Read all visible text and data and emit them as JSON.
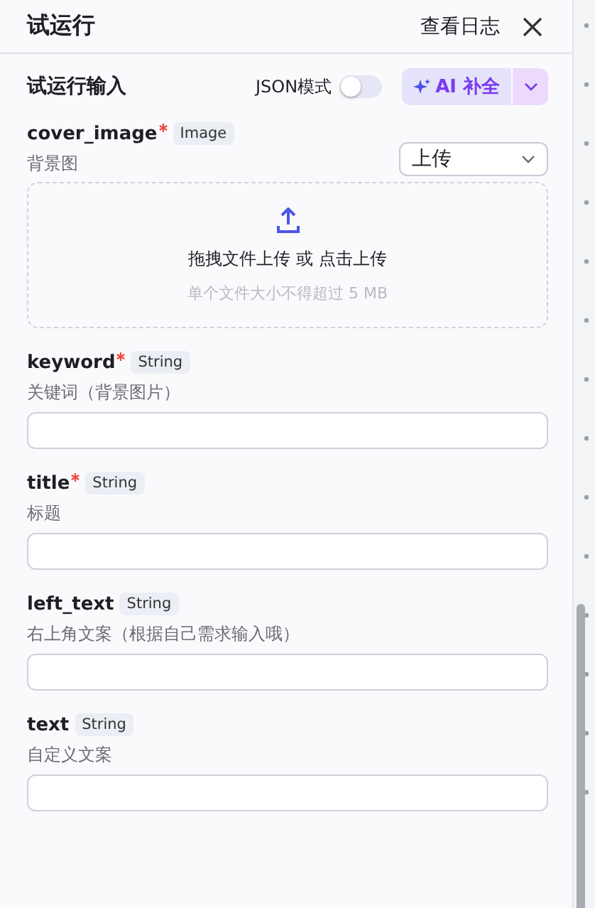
{
  "header": {
    "title": "试运行",
    "log_link": "查看日志"
  },
  "section": {
    "title": "试运行输入",
    "json_mode": {
      "label": "JSON模式",
      "on": false
    },
    "ai_button": "AI 补全"
  },
  "fields": [
    {
      "kind": "upload",
      "name": "cover_image",
      "required": true,
      "type": "Image",
      "description": "背景图",
      "mode": "上传",
      "upload_text": "拖拽文件上传 或 点击上传",
      "upload_hint": "单个文件大小不得超过 5 MB"
    },
    {
      "kind": "text",
      "name": "keyword",
      "required": true,
      "type": "String",
      "description": "关键词（背景图片）"
    },
    {
      "kind": "text",
      "name": "title",
      "required": true,
      "type": "String",
      "description": "标题"
    },
    {
      "kind": "text",
      "name": "left_text",
      "required": false,
      "type": "String",
      "description": "右上角文案（根据自己需求输入哦）"
    },
    {
      "kind": "text",
      "name": "text",
      "required": false,
      "type": "String",
      "description": "自定义文案"
    }
  ]
}
